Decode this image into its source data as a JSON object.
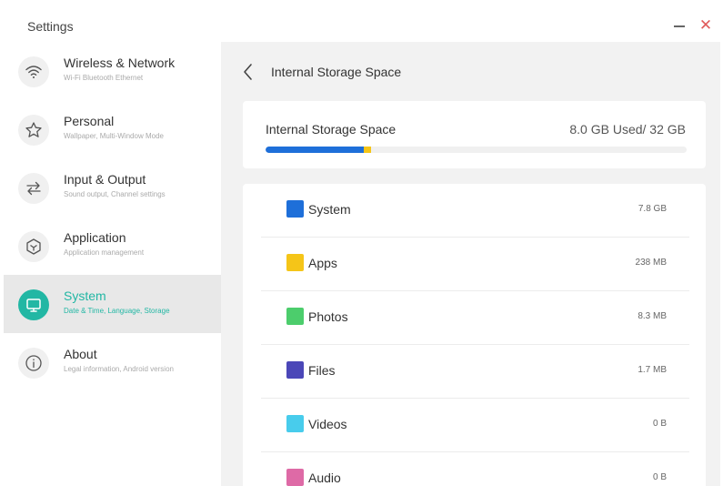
{
  "window": {
    "title": "Settings"
  },
  "sidebar": {
    "items": [
      {
        "label": "Wireless & Network",
        "sub": "Wi-Fi Bluetooth Ethernet",
        "icon": "wifi-icon"
      },
      {
        "label": "Personal",
        "sub": "Wallpaper, Multi-Window Mode",
        "icon": "star-icon"
      },
      {
        "label": "Input & Output",
        "sub": "Sound output, Channel settings",
        "icon": "swap-arrows-icon"
      },
      {
        "label": "Application",
        "sub": "Application management",
        "icon": "hexagon-icon"
      },
      {
        "label": "System",
        "sub": "Date & Time, Language, Storage",
        "icon": "monitor-icon",
        "active": true
      },
      {
        "label": "About",
        "sub": "Legal information, Android version",
        "icon": "info-icon"
      }
    ]
  },
  "header": {
    "title": "Internal Storage Space"
  },
  "storage": {
    "label": "Internal Storage Space",
    "value": "8.0 GB Used/ 32 GB",
    "used_fraction": 0.25
  },
  "categories": [
    {
      "label": "System",
      "value": "7.8 GB",
      "color": "#1e6fd9"
    },
    {
      "label": "Apps",
      "value": "238 MB",
      "color": "#f5c518"
    },
    {
      "label": "Photos",
      "value": "8.3 MB",
      "color": "#4ccd6c"
    },
    {
      "label": "Files",
      "value": "1.7 MB",
      "color": "#4b47b8"
    },
    {
      "label": "Videos",
      "value": "0 B",
      "color": "#48ccec"
    },
    {
      "label": "Audio",
      "value": "0 B",
      "color": "#de6aa6"
    }
  ],
  "colors": {
    "accent": "#22b7a4",
    "close": "#e05a5a"
  }
}
